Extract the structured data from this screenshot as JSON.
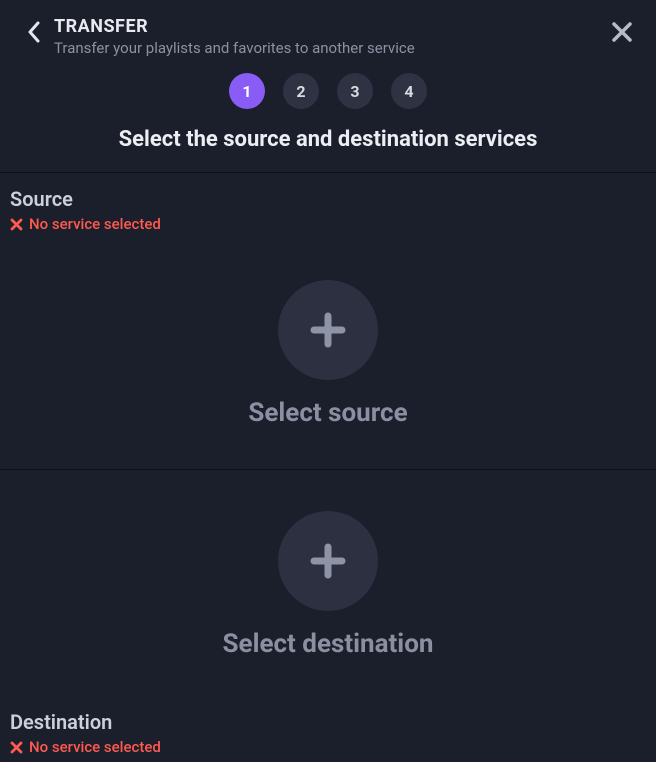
{
  "header": {
    "title": "TRANSFER",
    "subtitle": "Transfer your playlists and favorites to another service"
  },
  "steps": [
    "1",
    "2",
    "3",
    "4"
  ],
  "active_step_index": 0,
  "subtitle": "Select the source and destination services",
  "source": {
    "title": "Source",
    "error": "No service selected",
    "select_label": "Select source"
  },
  "destination": {
    "title": "Destination",
    "error": "No service selected",
    "select_label": "Select destination"
  }
}
